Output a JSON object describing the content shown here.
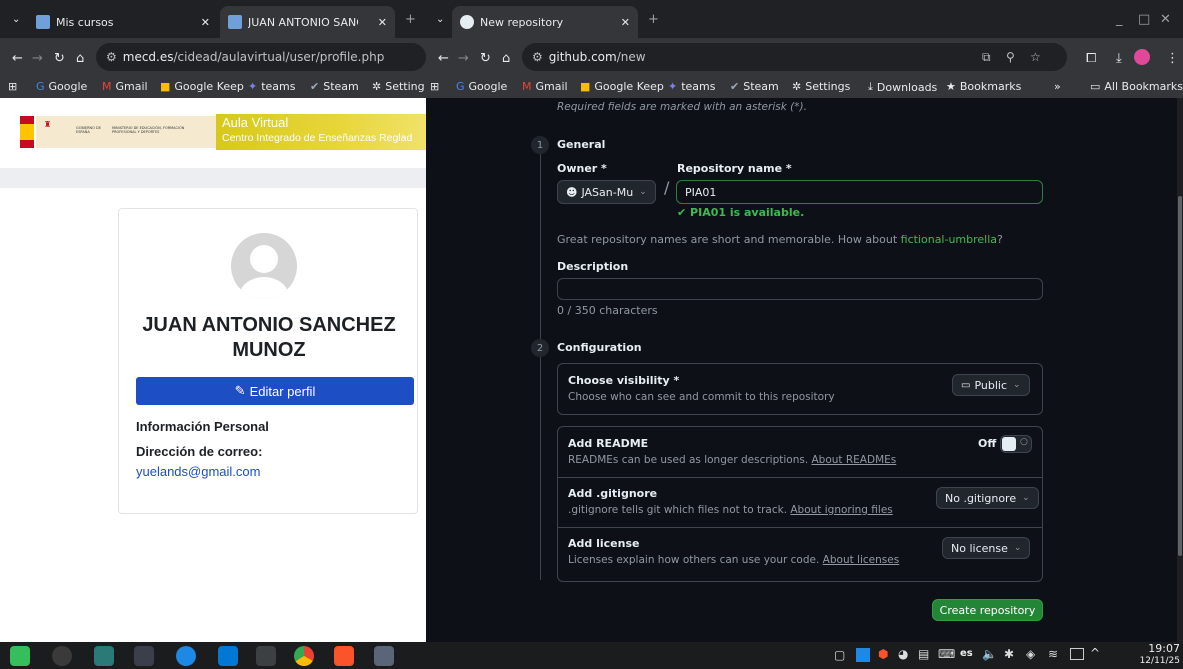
{
  "left_window": {
    "tabs": [
      {
        "title": "Mis cursos"
      },
      {
        "title": "JUAN ANTONIO SANCHEZ M"
      }
    ],
    "address": {
      "host": "mecd.es",
      "path": "/cidead/aulavirtual/user/profile.php"
    },
    "bookmarks": [
      "Google",
      "Gmail",
      "Google Keep",
      "teams",
      "Steam",
      "Setting"
    ],
    "banner": {
      "title": "Aula Virtual",
      "subtitle": "Centro Integrado de Enseñanzas Reglad",
      "gov_text": "GOBIERNO DE ESPAÑA",
      "ministry_text": "MINISTERIO DE EDUCACIÓN, FORMACIÓN PROFESIONAL Y DEPORTES"
    },
    "profile": {
      "name": "JUAN ANTONIO SANCHEZ MUNOZ",
      "edit_button": "Editar perfil",
      "section_title": "Información Personal",
      "email_label": "Dirección de correo:",
      "email": "yuelands@gmail.com"
    }
  },
  "right_window": {
    "tab_title": "New repository",
    "address": {
      "host": "github.com",
      "path": "/new"
    },
    "bookmarks": [
      "Google",
      "Gmail",
      "Google Keep",
      "teams",
      "Steam",
      "Settings",
      "Downloads",
      "Bookmarks"
    ],
    "overflow": "»",
    "all_bookmarks": "All Bookmarks",
    "form": {
      "required_note": "Required fields are marked with an asterisk (*).",
      "step1_num": "1",
      "step1_title": "General",
      "owner_label": "Owner *",
      "owner_value": "JASan-Mu",
      "slash": "/",
      "repo_label": "Repository name *",
      "repo_value": "PIA01",
      "available": "PIA01 is available.",
      "suggestion_prefix": "Great repository names are short and memorable. How about ",
      "suggestion_name": "fictional-umbrella",
      "suggestion_suffix": "?",
      "description_label": "Description",
      "description_value": "",
      "char_count": "0 / 350 characters",
      "step2_num": "2",
      "step2_title": "Configuration",
      "visibility_title": "Choose visibility *",
      "visibility_desc": "Choose who can see and commit to this repository",
      "visibility_value": "Public",
      "readme_title": "Add README",
      "readme_desc": "READMEs can be used as longer descriptions. ",
      "readme_link": "About READMEs",
      "readme_toggle": "Off",
      "gitignore_title": "Add .gitignore",
      "gitignore_desc": ".gitignore tells git which files not to track. ",
      "gitignore_link": "About ignoring files",
      "gitignore_value": "No .gitignore",
      "license_title": "Add license",
      "license_desc": "Licenses explain how others can use your code. ",
      "license_link": "About licenses",
      "license_value": "No license",
      "create_button": "Create repository"
    }
  },
  "taskbar": {
    "lang": "es",
    "time": "19:07",
    "date": "12/11/25"
  },
  "colors": {
    "github_bg": "#0d1117",
    "github_green": "#238636",
    "moodle_blue": "#1d4ec4",
    "chrome_dark": "#202124"
  }
}
